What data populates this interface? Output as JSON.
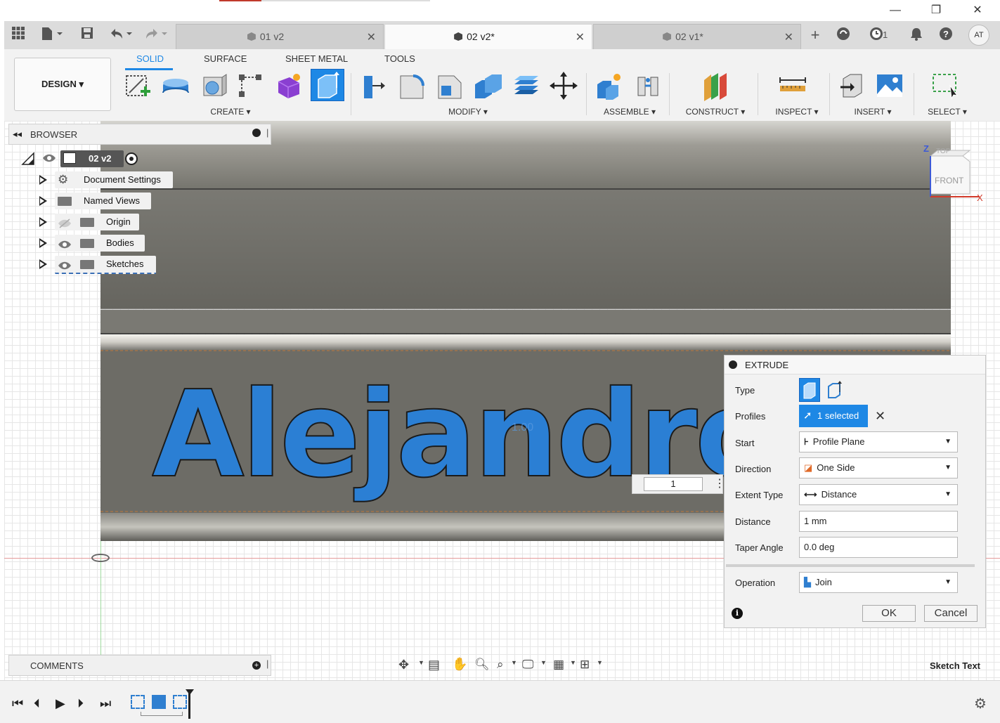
{
  "window": {
    "minimize": "—",
    "restore": "❐",
    "close": "✕"
  },
  "tabbar": {
    "tabs": [
      {
        "label": "01 v2",
        "active": false
      },
      {
        "label": "02 v2*",
        "active": true
      },
      {
        "label": "02 v1*",
        "active": false
      }
    ],
    "job_count": "1",
    "user_initials": "AT"
  },
  "toolbar": {
    "workspace": "DESIGN",
    "workspace_tabs": [
      "SOLID",
      "SURFACE",
      "SHEET METAL",
      "TOOLS"
    ],
    "groups": [
      "CREATE",
      "MODIFY",
      "ASSEMBLE",
      "CONSTRUCT",
      "INSPECT",
      "INSERT",
      "SELECT"
    ]
  },
  "browser": {
    "title": "BROWSER",
    "root": "02 v2",
    "items": [
      {
        "label": "Document Settings",
        "icon": "gear-icon"
      },
      {
        "label": "Named Views",
        "icon": "folder-icon"
      },
      {
        "label": "Origin",
        "icon": "folder-icon",
        "hidden": true
      },
      {
        "label": "Bodies",
        "icon": "folder-icon"
      },
      {
        "label": "Sketches",
        "icon": "folder-icon"
      }
    ]
  },
  "viewcube": {
    "top": "TOP",
    "front": "FRONT",
    "z": "Z",
    "x": "X"
  },
  "canvas": {
    "text": "Alejandro",
    "faint_dim": "1.00",
    "distance_input": "1"
  },
  "extrude": {
    "title": "EXTRUDE",
    "labels": {
      "type": "Type",
      "profiles": "Profiles",
      "start": "Start",
      "direction": "Direction",
      "extent_type": "Extent Type",
      "distance": "Distance",
      "taper_angle": "Taper Angle",
      "operation": "Operation"
    },
    "profiles_value": "1 selected",
    "start_value": "Profile Plane",
    "direction_value": "One Side",
    "extent_type_value": "Distance",
    "distance_value": "1 mm",
    "taper_value": "0.0 deg",
    "operation_value": "Join",
    "ok": "OK",
    "cancel": "Cancel"
  },
  "comments": {
    "title": "COMMENTS"
  },
  "status": {
    "selection": "Sketch Text"
  },
  "colors": {
    "accent": "#1e88e5",
    "text_fill": "#2b7fd4",
    "model_gray": "#6d6c66"
  }
}
